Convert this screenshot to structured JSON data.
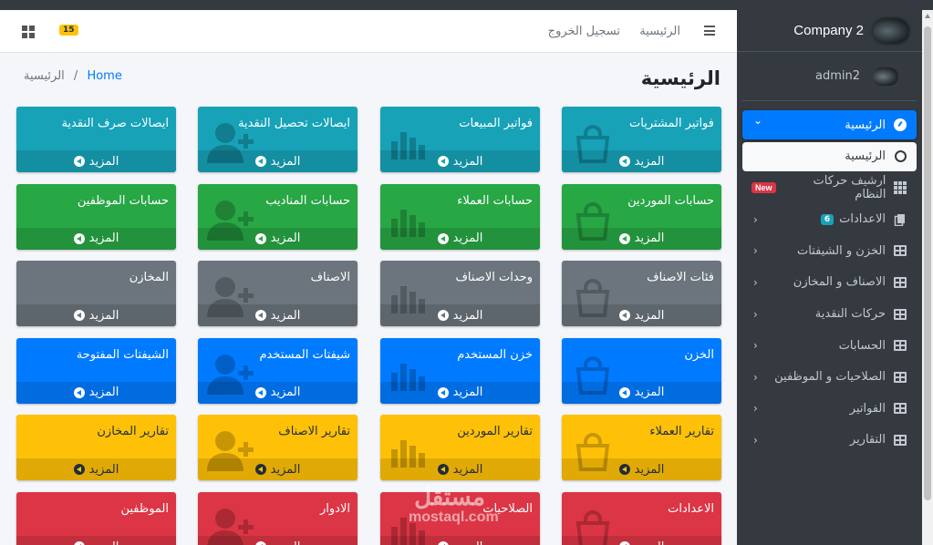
{
  "sidebar": {
    "brand": "Company 2",
    "user": "admin2",
    "items": [
      {
        "label": "الرئيسية",
        "icon": "dashboard-icon",
        "state": "active",
        "chevron": "down"
      },
      {
        "label": "الرئيسية",
        "icon": "circle-icon",
        "state": "sub-active"
      },
      {
        "label": "ارشيف حركات النظام",
        "icon": "grid-icon",
        "badge": "New"
      },
      {
        "label": "الاعدادات",
        "icon": "copy-icon",
        "badge": "6",
        "chevron": "left"
      },
      {
        "label": "الخزن و الشيفتات",
        "icon": "table-icon",
        "chevron": "left"
      },
      {
        "label": "الاصناف و المخازن",
        "icon": "table-icon",
        "chevron": "left"
      },
      {
        "label": "حركات النقدية",
        "icon": "table-icon",
        "chevron": "left"
      },
      {
        "label": "الحسابات",
        "icon": "table-icon",
        "chevron": "left"
      },
      {
        "label": "الصلاحيات و الموظفين",
        "icon": "table-icon",
        "chevron": "left"
      },
      {
        "label": "الفواتير",
        "icon": "table-icon",
        "chevron": "left"
      },
      {
        "label": "التقارير",
        "icon": "table-icon",
        "chevron": "left"
      }
    ]
  },
  "navbar": {
    "home_link": "الرئيسية",
    "logout_link": "تسجيل الخروج",
    "notifications": "15"
  },
  "header": {
    "title": "الرئيسية",
    "breadcrumb_home": "Home",
    "breadcrumb_sep": "/",
    "breadcrumb_current": "الرئيسية"
  },
  "more_label": "المزيد",
  "tile_rows": [
    {
      "color": "info",
      "tiles": [
        "فواتير المشتريات",
        "فواتير المبيعات",
        "ايصالات تحصيل النقدية",
        "ايصالات صرف النقدية"
      ]
    },
    {
      "color": "success",
      "tiles": [
        "حسابات الموردين",
        "حسابات العملاء",
        "حسابات المناديب",
        "حسابات الموظفين"
      ]
    },
    {
      "color": "secondary",
      "tiles": [
        "فئات الاصناف",
        "وحدات الاصناف",
        "الاصناف",
        "المخازن"
      ]
    },
    {
      "color": "primary",
      "tiles": [
        "الخزن",
        "خزن المستخدم",
        "شيفتات المستخدم",
        "الشيفتات المفتوحة"
      ]
    },
    {
      "color": "warning",
      "tiles": [
        "تقارير العملاء",
        "تقارير الموردين",
        "تقارير الاصناف",
        "تقارير المخازن"
      ]
    },
    {
      "color": "danger",
      "tiles": [
        "الاعدادات",
        "الصلاحيات",
        "الادوار",
        "الموظفين"
      ]
    }
  ],
  "tile_bg_icons": [
    "bag-icon",
    "chart-icon",
    "user-plus-icon",
    "none"
  ],
  "watermark": {
    "line1": "مستقل",
    "line2": "mostaql.com"
  }
}
